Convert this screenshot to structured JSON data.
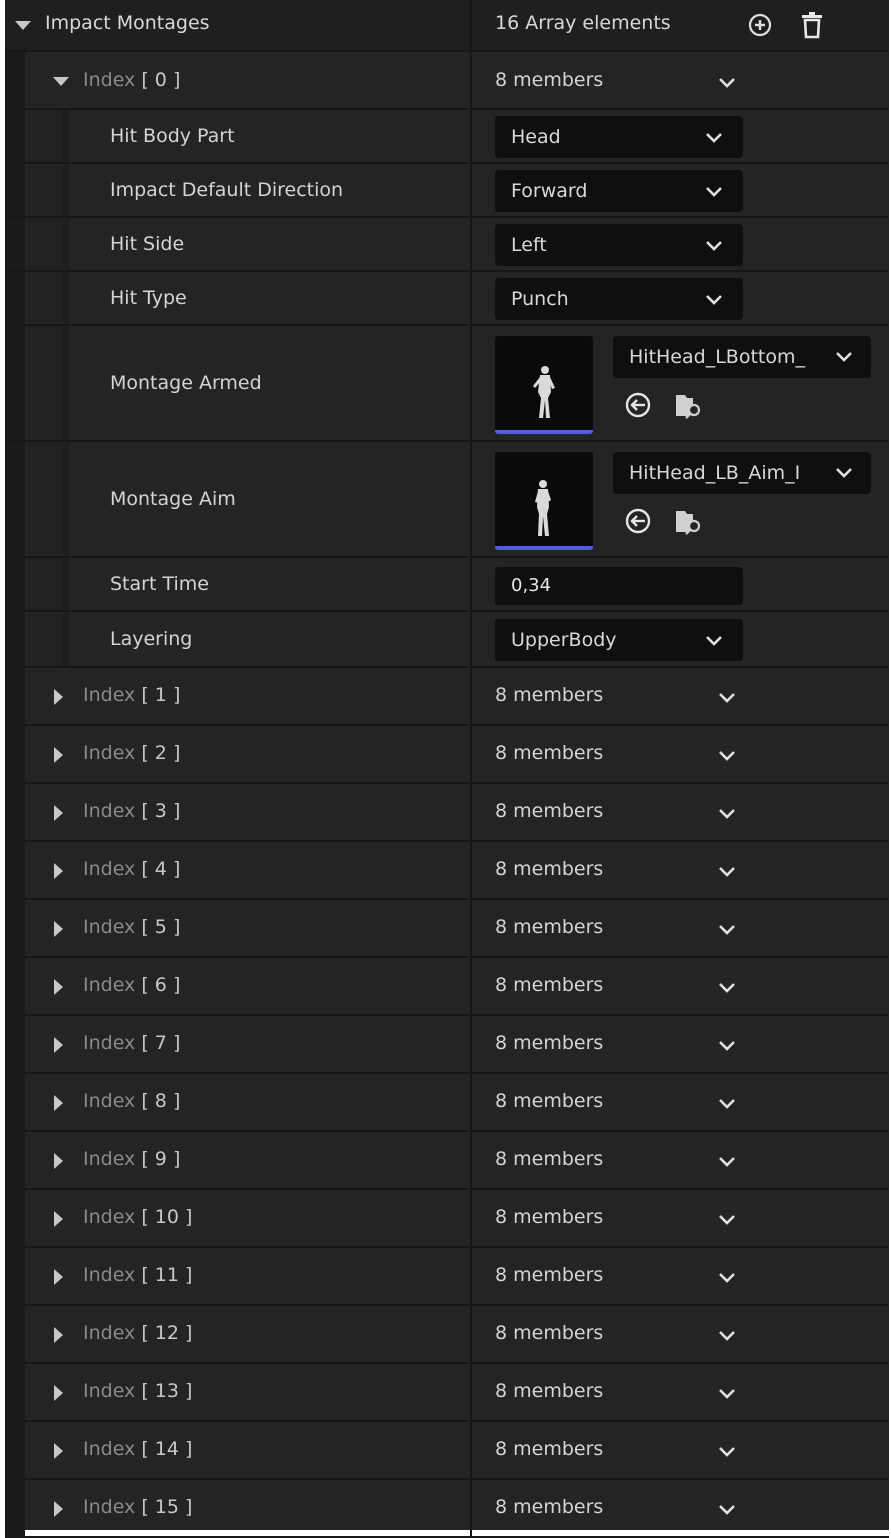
{
  "header": {
    "label": "Impact Montages",
    "value": "16 Array elements",
    "add_icon": "add-circle-icon",
    "delete_icon": "trash-icon"
  },
  "expanded_index": {
    "label_prefix": "Index",
    "label_index": "[ 0 ]",
    "members": "8 members",
    "properties": {
      "hit_body_part": {
        "label": "Hit Body Part",
        "value": "Head"
      },
      "impact_default_direction": {
        "label": "Impact Default Direction",
        "value": "Forward"
      },
      "hit_side": {
        "label": "Hit Side",
        "value": "Left"
      },
      "hit_type": {
        "label": "Hit Type",
        "value": "Punch"
      },
      "montage_armed": {
        "label": "Montage Armed",
        "asset": "HitHead_LBottom_"
      },
      "montage_aim": {
        "label": "Montage Aim",
        "asset": "HitHead_LB_Aim_I"
      },
      "start_time": {
        "label": "Start Time",
        "value": "0,34"
      },
      "layering": {
        "label": "Layering",
        "value": "UpperBody"
      }
    }
  },
  "collapsed_indices": [
    {
      "prefix": "Index",
      "index": "[ 1 ]",
      "members": "8 members"
    },
    {
      "prefix": "Index",
      "index": "[ 2 ]",
      "members": "8 members"
    },
    {
      "prefix": "Index",
      "index": "[ 3 ]",
      "members": "8 members"
    },
    {
      "prefix": "Index",
      "index": "[ 4 ]",
      "members": "8 members"
    },
    {
      "prefix": "Index",
      "index": "[ 5 ]",
      "members": "8 members"
    },
    {
      "prefix": "Index",
      "index": "[ 6 ]",
      "members": "8 members"
    },
    {
      "prefix": "Index",
      "index": "[ 7 ]",
      "members": "8 members"
    },
    {
      "prefix": "Index",
      "index": "[ 8 ]",
      "members": "8 members"
    },
    {
      "prefix": "Index",
      "index": "[ 9 ]",
      "members": "8 members"
    },
    {
      "prefix": "Index",
      "index": "[ 10 ]",
      "members": "8 members"
    },
    {
      "prefix": "Index",
      "index": "[ 11 ]",
      "members": "8 members"
    },
    {
      "prefix": "Index",
      "index": "[ 12 ]",
      "members": "8 members"
    },
    {
      "prefix": "Index",
      "index": "[ 13 ]",
      "members": "8 members"
    },
    {
      "prefix": "Index",
      "index": "[ 14 ]",
      "members": "8 members"
    },
    {
      "prefix": "Index",
      "index": "[ 15 ]",
      "members": "8 members"
    }
  ],
  "colors": {
    "panel_bg": "#242424",
    "row_divider": "#171717",
    "field_bg": "#0f0f0f",
    "thumbnail_accent": "#4f5ee0"
  }
}
